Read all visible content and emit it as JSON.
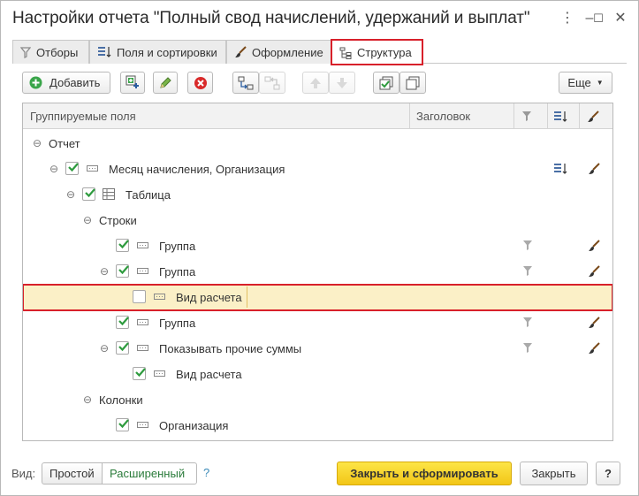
{
  "window": {
    "title": "Настройки отчета \"Полный свод начислений, удержаний и выплат\"",
    "menu_glyph": "⋮",
    "min_glyph": "–",
    "max_glyph": "☐",
    "close_glyph": "✕"
  },
  "tabs": [
    {
      "label": "Отборы",
      "icon": "filter-icon"
    },
    {
      "label": "Поля и сортировки",
      "icon": "fields-sort-icon"
    },
    {
      "label": "Оформление",
      "icon": "brush-icon"
    },
    {
      "label": "Структура",
      "icon": "structure-icon",
      "active": true
    }
  ],
  "toolbar": {
    "add_label": "Добавить",
    "more_label": "Еще"
  },
  "grid": {
    "columns": {
      "fields": "Группируемые поля",
      "heading": "Заголовок"
    },
    "rows": [
      {
        "label": "Отчет",
        "toggle": "⊖",
        "level": 0
      },
      {
        "label": "Месяц начисления, Организация",
        "toggle": "⊖",
        "checked": true,
        "level": 1
      },
      {
        "label": "Таблица",
        "toggle": "⊖",
        "checked": true,
        "level": 2
      },
      {
        "label": "Строки",
        "toggle": "⊖",
        "level": 3
      },
      {
        "label": "Группа",
        "checked": true,
        "level": 4
      },
      {
        "label": "Группа",
        "toggle": "⊖",
        "checked": true,
        "level": 4
      },
      {
        "label": "Вид расчета",
        "checked": false,
        "level": 5,
        "selected": true
      },
      {
        "label": "Группа",
        "checked": true,
        "level": 4
      },
      {
        "label": "Показывать прочие суммы",
        "toggle": "⊖",
        "checked": true,
        "level": 4
      },
      {
        "label": "Вид расчета",
        "checked": true,
        "level": 5
      },
      {
        "label": "Колонки",
        "toggle": "⊖",
        "level": 3
      },
      {
        "label": "Организация",
        "checked": true,
        "level": 4
      }
    ]
  },
  "footer": {
    "view_label": "Вид:",
    "simple_label": "Простой",
    "extended_label": "Расширенный",
    "help_label": "?",
    "close_generate_label": "Закрыть и сформировать",
    "close_label": "Закрыть",
    "question_label": "?"
  },
  "colors": {
    "highlight_border": "#d8202a",
    "selected_row_bg": "#fbf0c7",
    "check_green": "#2e9b3e",
    "primary_button": "#f5cf1f"
  }
}
